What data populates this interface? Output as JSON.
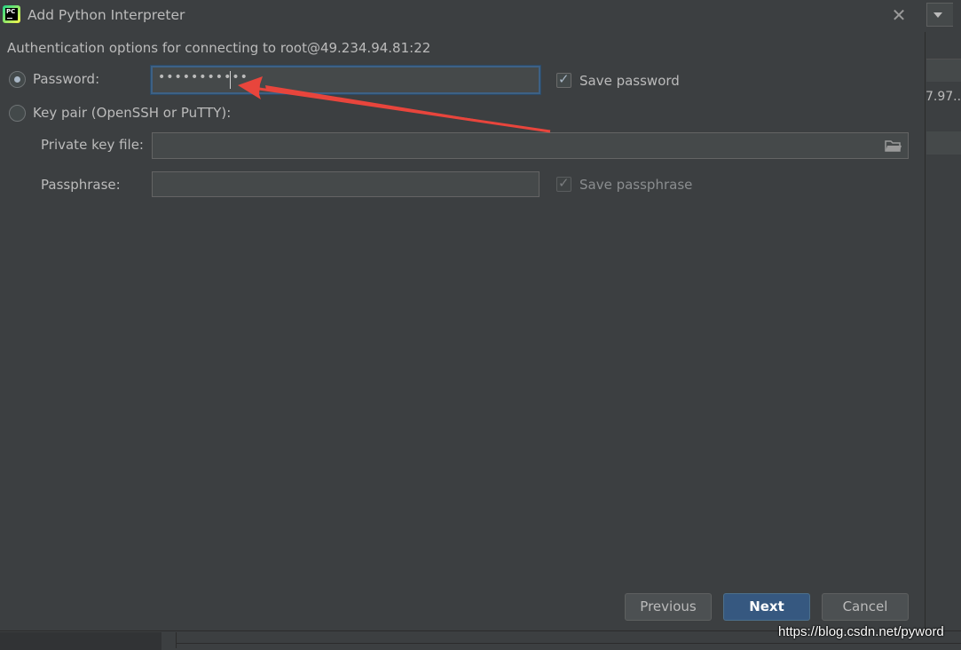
{
  "window": {
    "title": "Add Python Interpreter",
    "app_icon_text": "PC",
    "close_glyph": "✕"
  },
  "auth": {
    "heading": "Authentication options for connecting to root@49.234.94.81:22",
    "password_radio_label": "Password:",
    "password_value": "•••••••••••",
    "save_password_label": "Save password",
    "keypair_radio_label": "Key pair (OpenSSH or PuTTY):",
    "private_key_label": "Private key file:",
    "private_key_value": "",
    "passphrase_label": "Passphrase:",
    "passphrase_value": "",
    "save_passphrase_label": "Save passphrase"
  },
  "buttons": {
    "previous": "Previous",
    "next": "Next",
    "cancel": "Cancel"
  },
  "background": {
    "truncated_text": "7.97..."
  },
  "watermark": "https://blog.csdn.net/pyword",
  "icons": {
    "app": "pycharm-icon",
    "close": "close-icon",
    "folder": "folder-icon",
    "dropdown": "chevron-down-icon"
  },
  "colors": {
    "background": "#3c3f41",
    "focus_border": "#3d6185",
    "primary_button": "#365880",
    "annotation_arrow": "#e8453c"
  }
}
